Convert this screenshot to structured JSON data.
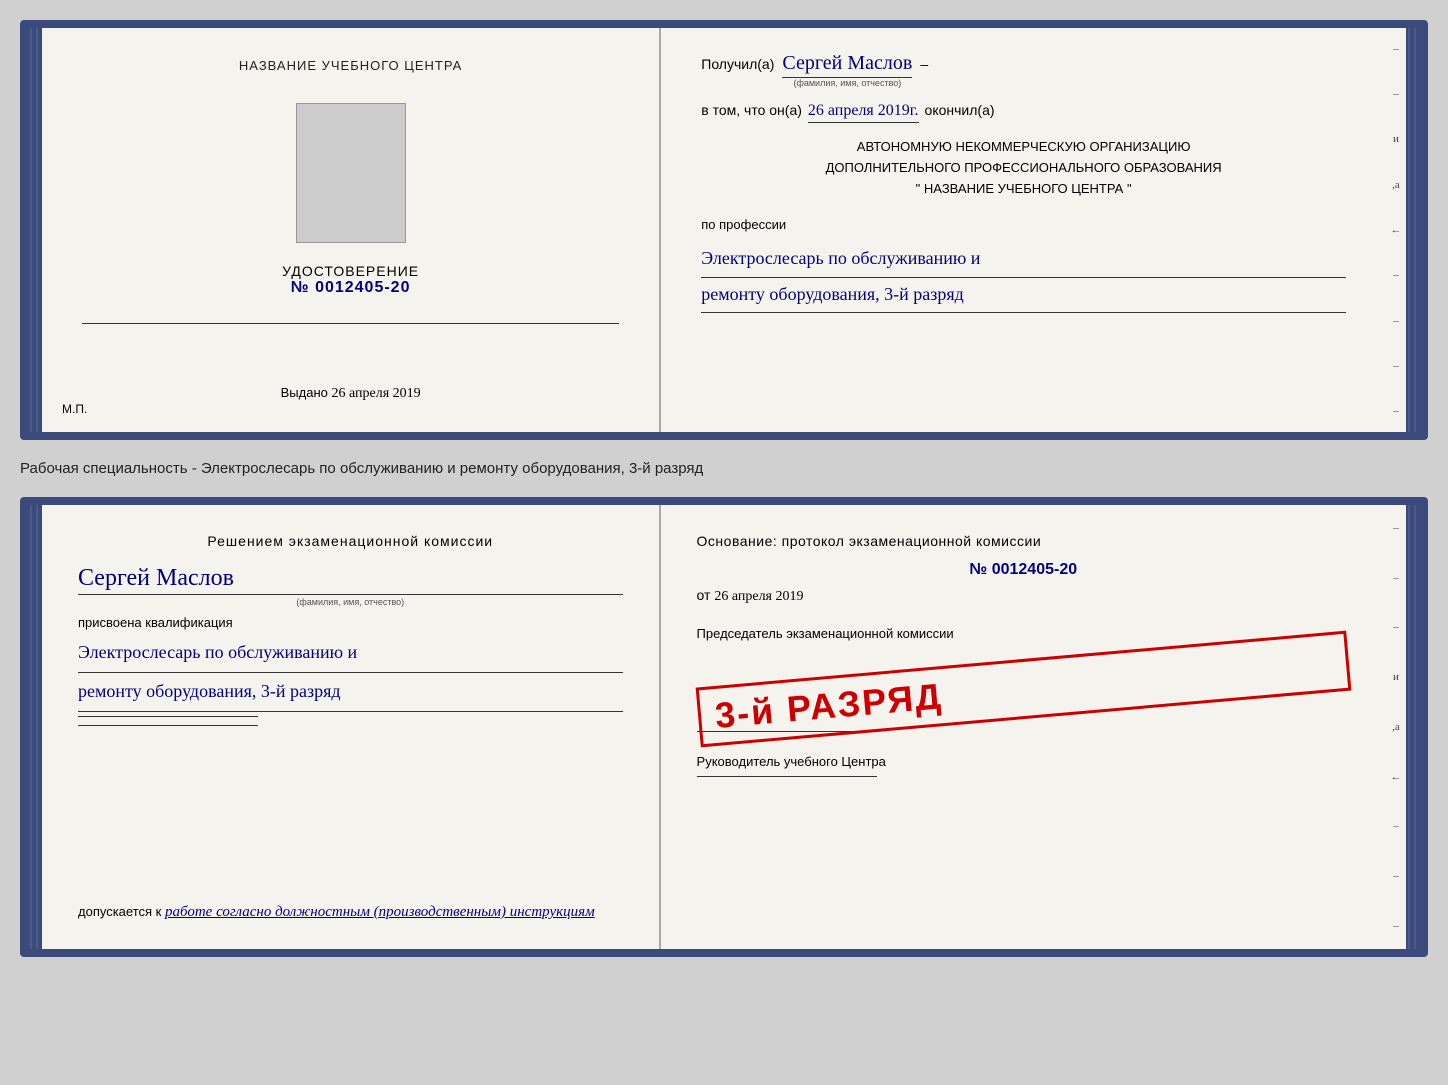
{
  "doc1": {
    "left": {
      "center_title": "НАЗВАНИЕ УЧЕБНОГО ЦЕНТРА",
      "photo_alt": "фото",
      "udostoverenie_label": "УДОСТОВЕРЕНИЕ",
      "number_prefix": "№",
      "number": "0012405-20",
      "vydano_label": "Выдано",
      "vydano_date": "26 апреля 2019",
      "mp_label": "М.П."
    },
    "right": {
      "poluchil_label": "Получил(а)",
      "recipient_name": "Сергей Маслов",
      "fio_label": "(фамилия, имя, отчество)",
      "dash": "–",
      "vtom_label": "в том, что он(а)",
      "date_value": "26 апреля 2019г.",
      "okonchil_label": "окончил(а)",
      "org_line1": "АВТОНОМНУЮ НЕКОММЕРЧЕСКУЮ ОРГАНИЗАЦИЮ",
      "org_line2": "ДОПОЛНИТЕЛЬНОГО ПРОФЕССИОНАЛЬНОГО ОБРАЗОВАНИЯ",
      "org_quote": "\"",
      "org_name": "НАЗВАНИЕ УЧЕБНОГО ЦЕНТРА",
      "org_quote2": "\"",
      "po_professii_label": "по профессии",
      "profession_line1": "Электрослесарь по обслуживанию и",
      "profession_line2": "ремонту оборудования, 3-й разряд"
    }
  },
  "specialty_text": "Рабочая специальность - Электрослесарь по обслуживанию и ремонту оборудования, 3-й разряд",
  "doc2": {
    "left": {
      "resheniem_label": "Решением экзаменационной комиссии",
      "name": "Сергей Маслов",
      "fio_label": "(фамилия, имя, отчество)",
      "prisvoena_label": "присвоена квалификация",
      "qual_line1": "Электрослесарь по обслуживанию и",
      "qual_line2": "ремонту оборудования, 3-й разряд",
      "dopuskaetsya_label": "допускается к",
      "dopuskaetsya_value": "работе согласно должностным (производственным) инструкциям"
    },
    "right": {
      "osnovanie_label": "Основание: протокол экзаменационной комиссии",
      "number_prefix": "№",
      "number": "0012405-20",
      "ot_label": "от",
      "ot_date": "26 апреля 2019",
      "chairman_label": "Председатель экзаменационной комиссии",
      "stamp_text": "3-й РАЗРЯД",
      "rukovoditel_label": "Руководитель учебного Центра"
    }
  }
}
